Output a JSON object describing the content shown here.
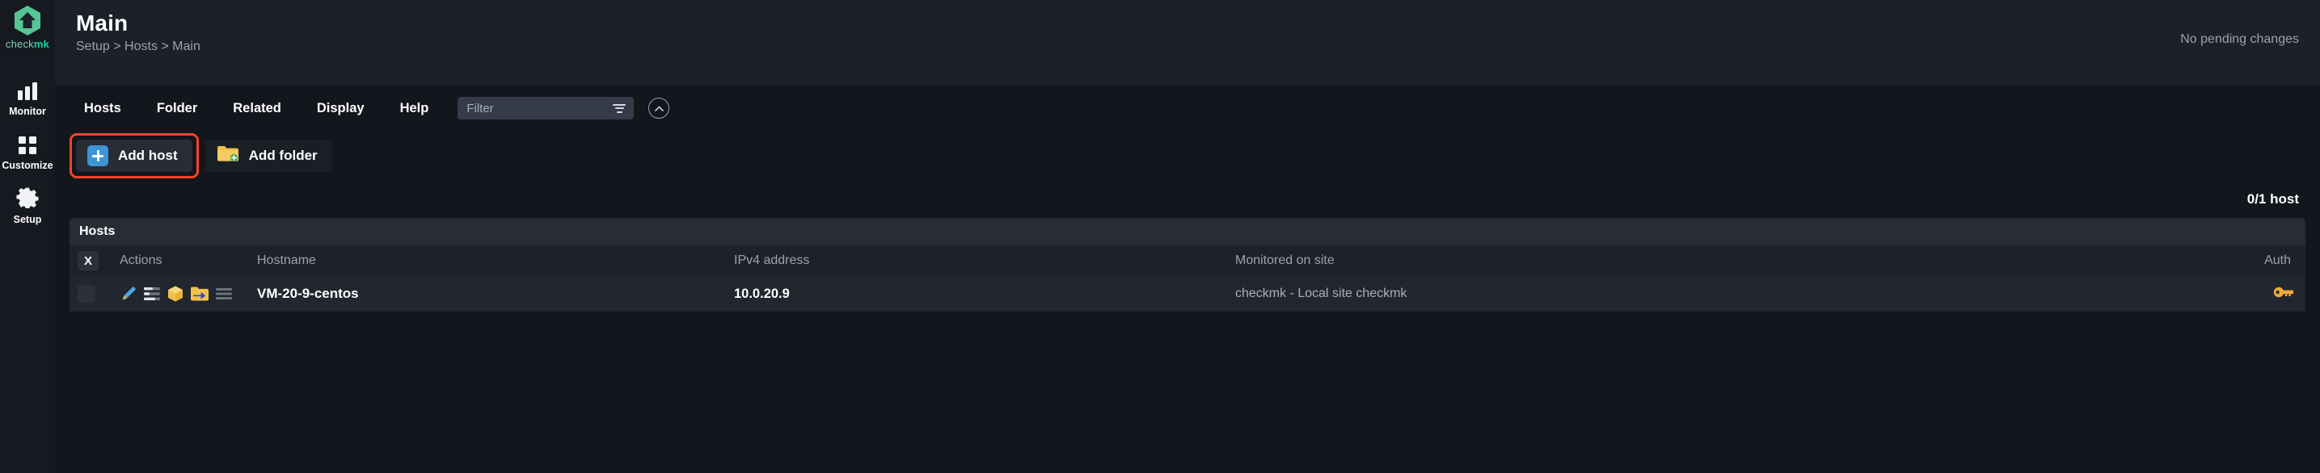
{
  "sidebar": {
    "logo": {
      "text_light": "check",
      "text_bold": "mk",
      "icon": "checkmk-hexagon-logo"
    },
    "items": [
      {
        "label": "Monitor",
        "icon": "bar-chart-icon"
      },
      {
        "label": "Customize",
        "icon": "grid-squares-icon"
      },
      {
        "label": "Setup",
        "icon": "gear-icon"
      }
    ]
  },
  "header": {
    "title": "Main",
    "breadcrumb": "Setup > Hosts > Main",
    "pending_changes": "No pending changes"
  },
  "menubar": {
    "items": [
      "Hosts",
      "Folder",
      "Related",
      "Display",
      "Help"
    ],
    "filter": {
      "placeholder": "Filter",
      "value": "",
      "icon": "filter-icon"
    },
    "collapse": {
      "icon": "chevron-up-circle-icon"
    }
  },
  "actions": {
    "add_host": {
      "label": "Add host",
      "icon": "blue-plus-icon",
      "highlighted": true,
      "highlight_color": "#f5442a"
    },
    "add_folder": {
      "label": "Add folder",
      "icon": "folder-plus-icon",
      "highlighted": false
    }
  },
  "summary": {
    "host_count": "0/1 host"
  },
  "table": {
    "title": "Hosts",
    "columns": [
      "X",
      "Actions",
      "Hostname",
      "IPv4 address",
      "Monitored on site",
      "Auth"
    ],
    "rows": [
      {
        "selected": false,
        "actions": [
          "edit-pencil-icon",
          "parameters-sliders-icon",
          "service-discovery-cube-icon",
          "move-to-folder-icon",
          "detail-lines-icon"
        ],
        "hostname": "VM-20-9-centos",
        "ipv4": "10.0.20.9",
        "site": "checkmk - Local site checkmk",
        "auth": "key-icon"
      }
    ]
  },
  "colors": {
    "accent_green": "#15d1a0",
    "highlight_red": "#f5442a",
    "plus_blue": "#3d94d6",
    "folder_yellow": "#f2c14b",
    "key_orange": "#f0a93b"
  }
}
